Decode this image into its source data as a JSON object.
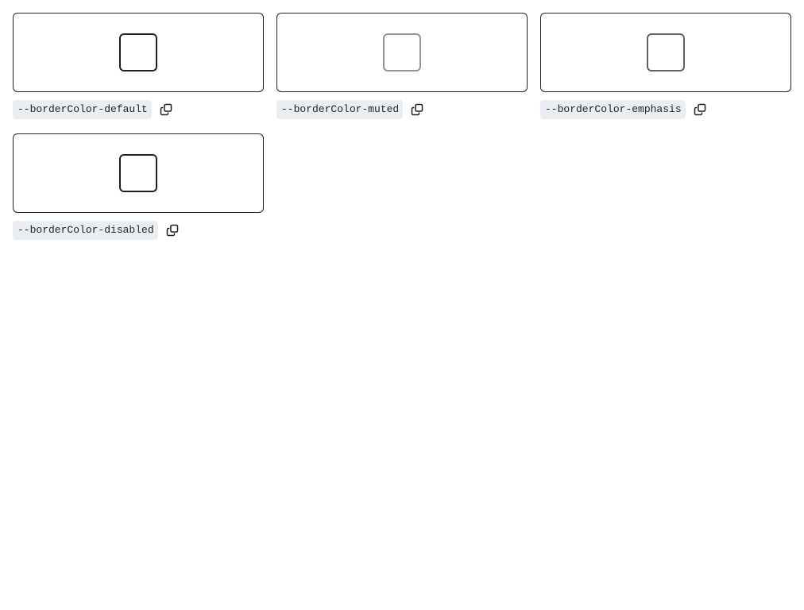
{
  "tokens": [
    {
      "name": "--borderColor-default",
      "color": "#1f2328"
    },
    {
      "name": "--borderColor-muted",
      "color": "#8c959f"
    },
    {
      "name": "--borderColor-emphasis",
      "color": "#59636e"
    },
    {
      "name": "--borderColor-disabled",
      "color": "#1f2328"
    }
  ],
  "icons": {
    "copy": "copy-icon"
  },
  "colors": {
    "card_border": "#1f2328",
    "label_background": "#eaeef2"
  }
}
